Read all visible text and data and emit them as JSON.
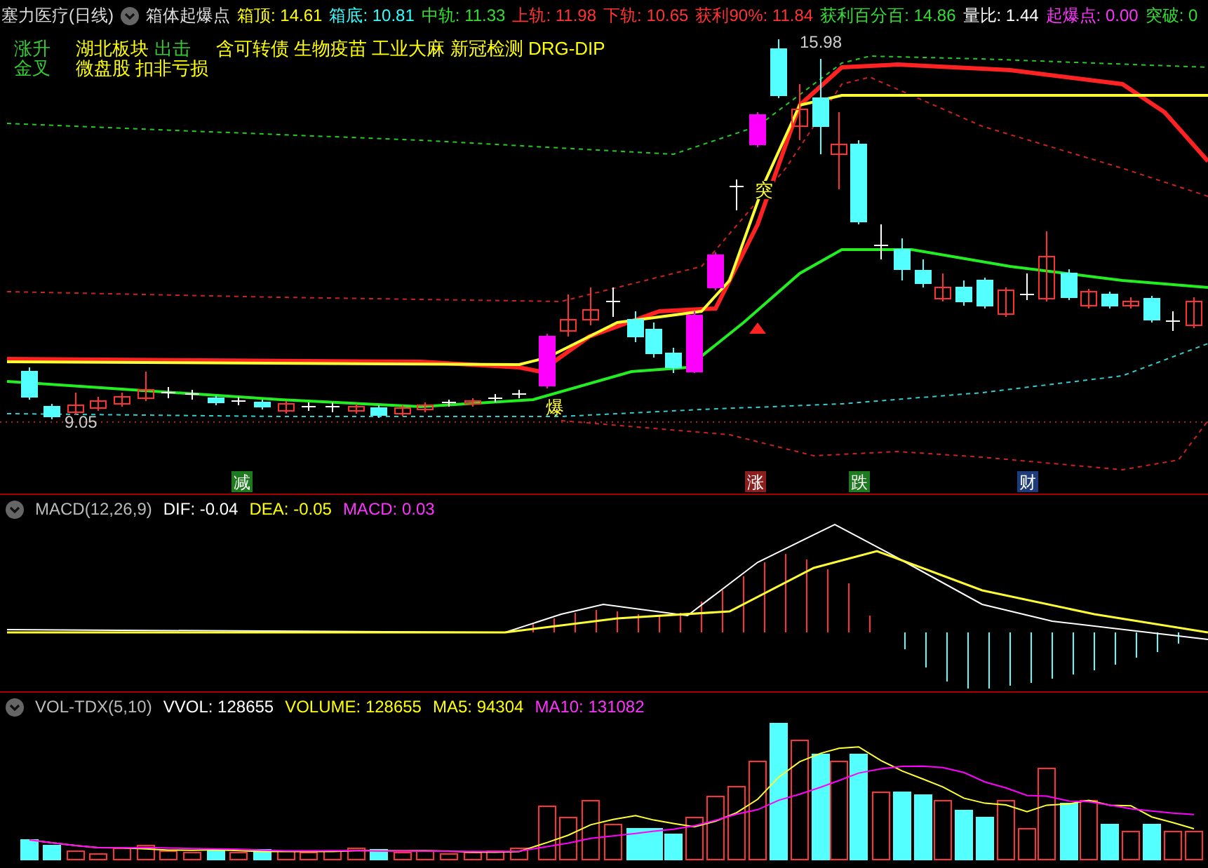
{
  "main_panel": {
    "stock": "塞力医疗(日线)",
    "indicator": "箱体起爆点",
    "readings": [
      {
        "text": "箱顶: 14.61",
        "color": "#ffff00"
      },
      {
        "text": "箱底: 10.81",
        "color": "#33ffff"
      },
      {
        "text": "中轨: 11.33",
        "color": "#33dd33"
      },
      {
        "text": "上轨: 11.98",
        "color": "#ff3333"
      },
      {
        "text": "下轨: 10.65",
        "color": "#ff3333"
      },
      {
        "text": "获利90%: 11.84",
        "color": "#ff3333"
      },
      {
        "text": "获利百分百: 14.86",
        "color": "#33dd33"
      },
      {
        "text": "量比: 1.44",
        "color": "#ffffff"
      },
      {
        "text": "起爆点: 0.00",
        "color": "#ff33ff"
      },
      {
        "text": "突破: 0",
        "color": "#33dd33"
      }
    ],
    "signals": [
      "涨升",
      "金叉"
    ],
    "tag_lines": [
      [
        {
          "text": "湖北板块",
          "color": "#ffff00"
        },
        {
          "text": "出击",
          "color": "#33cc33"
        },
        {
          "text": "含可转债 生物疫苗 工业大麻 新冠检测 DRG-DIP",
          "color": "#ffff00"
        }
      ],
      [
        {
          "text": "微盘股 扣非亏损",
          "color": "#ffff00"
        }
      ]
    ],
    "chart_labels": {
      "high": "15.98",
      "low": "9.05",
      "break": "突",
      "burst": "爆"
    },
    "markers": [
      {
        "text": "减",
        "color": "#1e7a1e"
      },
      {
        "text": "涨",
        "color": "#8b1e1e"
      },
      {
        "text": "跌",
        "color": "#1e7a1e"
      },
      {
        "text": "财",
        "color": "#1e3c7a"
      }
    ]
  },
  "macd_panel": {
    "title": "MACD(12,26,9)",
    "values": [
      {
        "text": "DIF: -0.04",
        "color": "#ffffff"
      },
      {
        "text": "DEA: -0.05",
        "color": "#ffff00"
      },
      {
        "text": "MACD: 0.03",
        "color": "#ff33ff"
      }
    ]
  },
  "vol_panel": {
    "title": "VOL-TDX(5,10)",
    "values": [
      {
        "text": "VVOL: 128655",
        "color": "#ffffff"
      },
      {
        "text": "VOLUME: 128655",
        "color": "#ffff00"
      },
      {
        "text": "MA5: 94304",
        "color": "#ffff00"
      },
      {
        "text": "MA10: 131082",
        "color": "#ff33ff"
      }
    ]
  }
}
